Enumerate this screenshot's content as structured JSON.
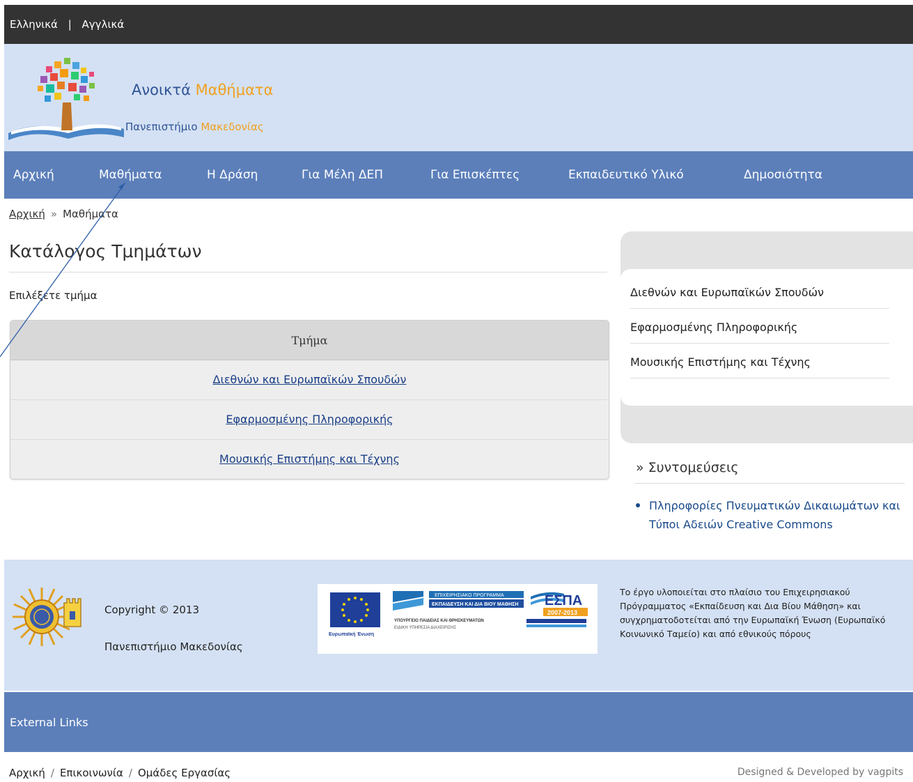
{
  "lang": {
    "greek": "Ελληνικά",
    "separator": "|",
    "english": "Αγγλικά"
  },
  "header": {
    "title_part1": "Ανοικτά",
    "title_part2": "Μαθήματα",
    "subtitle_part1": "Πανεπιστήμιο",
    "subtitle_part2": "Μακεδονίας",
    "colors": {
      "background": "#d4e1f4",
      "blue": "#2f5496",
      "orange": "#f0a020"
    }
  },
  "nav": {
    "items": [
      {
        "label": "Αρχική"
      },
      {
        "label": "Μαθήματα"
      },
      {
        "label": "Η Δράση"
      },
      {
        "label": "Για Μέλη ΔΕΠ"
      },
      {
        "label": "Για Επισκέπτες"
      },
      {
        "label": "Εκπαιδευτικό Υλικό"
      },
      {
        "label": "Δημοσιότητα"
      }
    ],
    "color": "#5c7fba"
  },
  "breadcrumb": {
    "home": "Αρχική",
    "separator": "»",
    "current": "Μαθήματα"
  },
  "page": {
    "title": "Κατάλογος Τμημάτων",
    "select_label": "Επιλέξετε τμήμα"
  },
  "table": {
    "header": "Τμήμα",
    "rows": [
      {
        "label": "Διεθνών και Ευρωπαϊκών Σπουδών"
      },
      {
        "label": "Εφαρμοσμένης Πληροφορικής"
      },
      {
        "label": "Μουσικής Επιστήμης και Τέχνης"
      }
    ]
  },
  "sidebar": {
    "links": [
      {
        "label": "Διεθνών και Ευρωπαϊκών Σπουδών"
      },
      {
        "label": "Εφαρμοσμένης Πληροφορικής"
      },
      {
        "label": "Μουσικής Επιστήμης και Τέχνης"
      }
    ],
    "shortcuts_title": "» Συντομεύσεις",
    "shortcut_link": "Πληροφορίες Πνευματικών Δικαιωμάτων και Τύποι Αδειών Creative Commons"
  },
  "footer": {
    "copyright": "Copyright © 2013",
    "university": "Πανεπιστήμιο Μακεδονίας",
    "funding_text": "Το έργο υλοποιείται στο πλαίσιο του Επιχειρησιακού Πρόγραμματος «Εκπαίδευση και Δια Βίου Μάθηση» και συγχρηματοδοτείται από την Ευρωπαϊκή Ένωση (Ευρωπαϊκό Κοινωνικό Ταμείο) και από εθνικούς πόρους",
    "espa_banner": {
      "program_line1": "ΕΠΙΧΕΙΡΗΣΙΑΚΟ ΠΡΟΓΡΑΜΜΑ",
      "program_line2": "ΕΚΠΑΙΔΕΥΣΗ ΚΑΙ ΔΙΑ ΒΙΟΥ ΜΑΘΗΣΗ",
      "ministry_line1": "ΥΠΟΥΡΓΕΙΟ ΠΑΙΔΕΙΑΣ ΚΑΙ ΘΡΗΣΚΕΥΜΑΤΩΝ",
      "ministry_line2": "ΕΙΔΙΚΗ ΥΠΗΡΕΣΙΑ ΔΙΑΧΕΙΡΙΣΗΣ",
      "eu_label": "Ευρωπαϊκή Ένωση",
      "espa": "ΕΣΠΑ",
      "years": "2007-2013"
    },
    "external_links": "External Links",
    "bottom_links": [
      "Αρχική",
      "Επικοινωνία",
      "Ομάδες Εργασίας"
    ],
    "bottom_separator": "/",
    "credits": "Designed & Developed by vagpits"
  }
}
